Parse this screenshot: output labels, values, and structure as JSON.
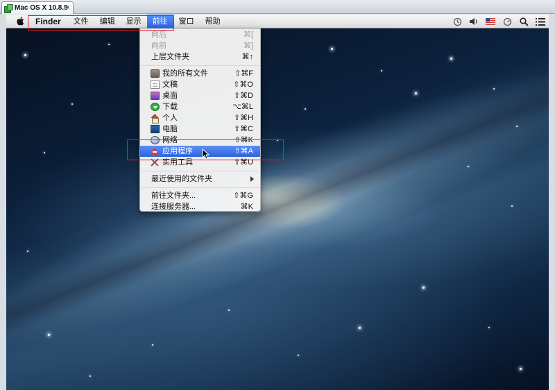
{
  "vm_tab": {
    "title": "Mac OS X 10.8.5",
    "close": "×"
  },
  "menubar": {
    "app_name": "Finder",
    "items": [
      "文件",
      "编辑",
      "显示",
      "前往",
      "窗口",
      "帮助"
    ],
    "active_item": "前往"
  },
  "go_menu": {
    "items": [
      {
        "label": "向后",
        "shortcut": "⌘[",
        "disabled": true
      },
      {
        "label": "向前",
        "shortcut": "⌘]",
        "disabled": true
      },
      {
        "label": "上层文件夹",
        "shortcut": "⌘↑"
      },
      {
        "label": "我的所有文件",
        "shortcut": "⇧⌘F",
        "icon": "all-my-files-icon"
      },
      {
        "label": "文稿",
        "shortcut": "⇧⌘O",
        "icon": "documents-icon"
      },
      {
        "label": "桌面",
        "shortcut": "⇧⌘D",
        "icon": "desktop-icon"
      },
      {
        "label": "下载",
        "shortcut": "⌥⌘L",
        "icon": "downloads-icon"
      },
      {
        "label": "个人",
        "shortcut": "⇧⌘H",
        "icon": "home-icon"
      },
      {
        "label": "电脑",
        "shortcut": "⇧⌘C",
        "icon": "computer-icon"
      },
      {
        "label": "网络",
        "shortcut": "⇧⌘K",
        "icon": "network-icon"
      },
      {
        "label": "应用程序",
        "shortcut": "⇧⌘A",
        "icon": "applications-icon",
        "highlighted": true
      },
      {
        "label": "实用工具",
        "shortcut": "⇧⌘U",
        "icon": "utilities-icon"
      },
      {
        "label": "最近使用的文件夹",
        "submenu": true
      },
      {
        "label": "前往文件夹...",
        "shortcut": "⇧⌘G"
      },
      {
        "label": "连接服务器...",
        "shortcut": "⌘K"
      }
    ]
  },
  "status_icons": [
    "time-machine-icon",
    "volume-icon",
    "flag-icon",
    "sync-icon",
    "spotlight-icon",
    "notification-icon"
  ],
  "colors": {
    "highlight": "#2d62df",
    "annotation": "#e02020"
  }
}
